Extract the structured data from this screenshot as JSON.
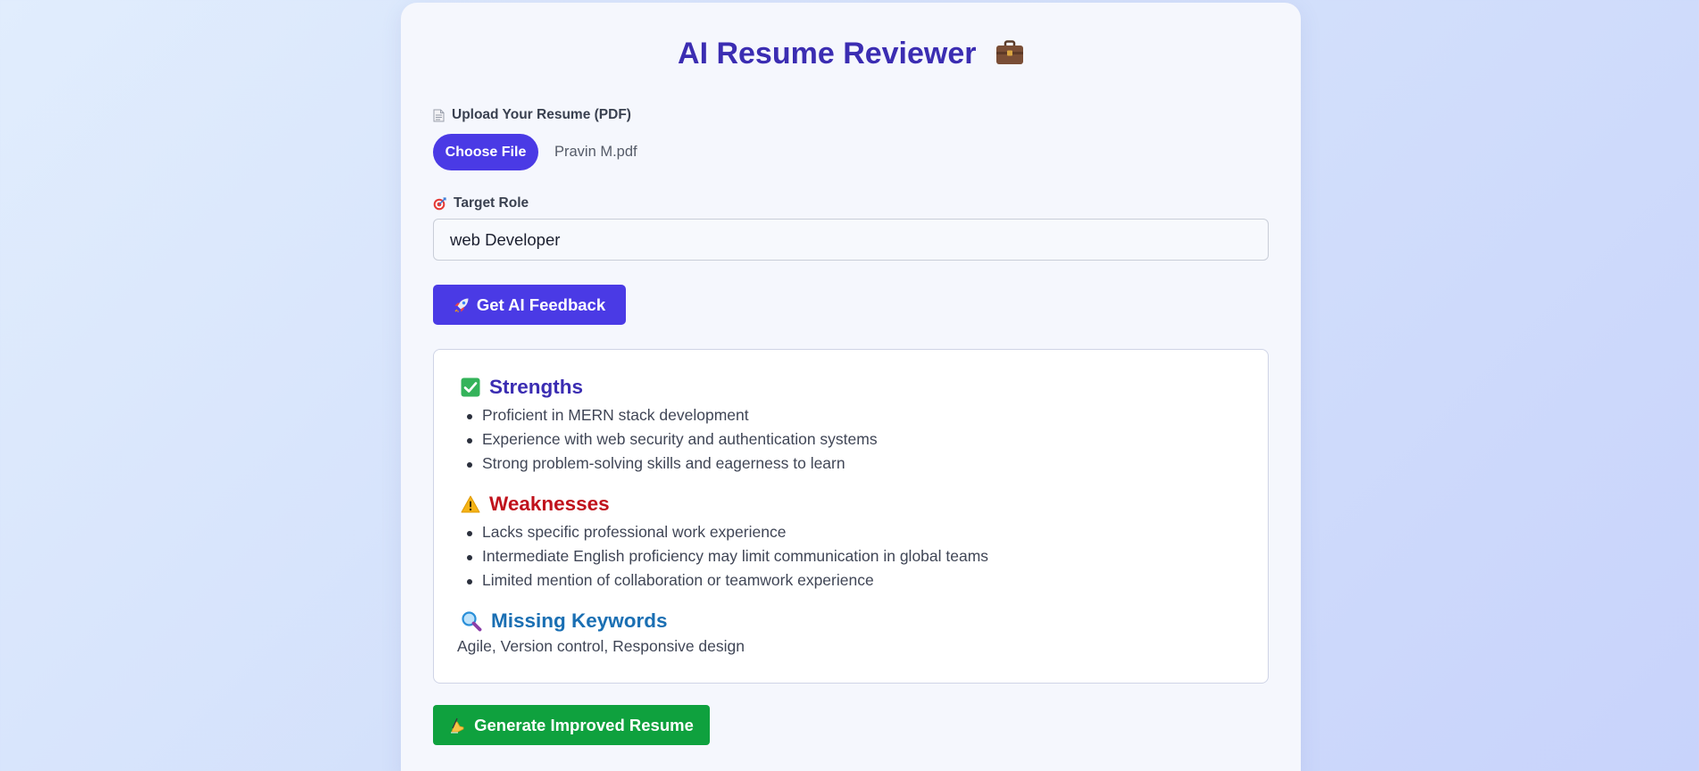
{
  "app": {
    "title": "AI Resume Reviewer",
    "title_icon": "briefcase-icon"
  },
  "upload": {
    "label": "Upload Your Resume (PDF)",
    "label_icon": "document-icon",
    "button_label": "Choose File",
    "file_name": "Pravin M.pdf"
  },
  "role": {
    "label": "Target Role",
    "label_icon": "target-icon",
    "value": "web Developer"
  },
  "feedback_button": {
    "label": "Get AI Feedback",
    "icon": "rocket-icon"
  },
  "results": {
    "strengths": {
      "heading": "Strengths",
      "icon": "check-icon",
      "items": [
        "Proficient in MERN stack development",
        "Experience with web security and authentication systems",
        "Strong problem-solving skills and eagerness to learn"
      ]
    },
    "weaknesses": {
      "heading": "Weaknesses",
      "icon": "warning-icon",
      "items": [
        "Lacks specific professional work experience",
        "Intermediate English proficiency may limit communication in global teams",
        "Limited mention of collaboration or teamwork experience"
      ]
    },
    "missing_keywords": {
      "heading": "Missing Keywords",
      "icon": "magnifier-icon",
      "text": "Agile, Version control, Responsive design"
    }
  },
  "generate_button": {
    "label": "Generate Improved Resume",
    "icon": "writing-hand-icon"
  },
  "colors": {
    "primary": "#4a3ae5",
    "title": "#3b2db2",
    "weakness": "#c0121c",
    "keywords": "#1a6fb3",
    "success": "#0fa13e"
  }
}
